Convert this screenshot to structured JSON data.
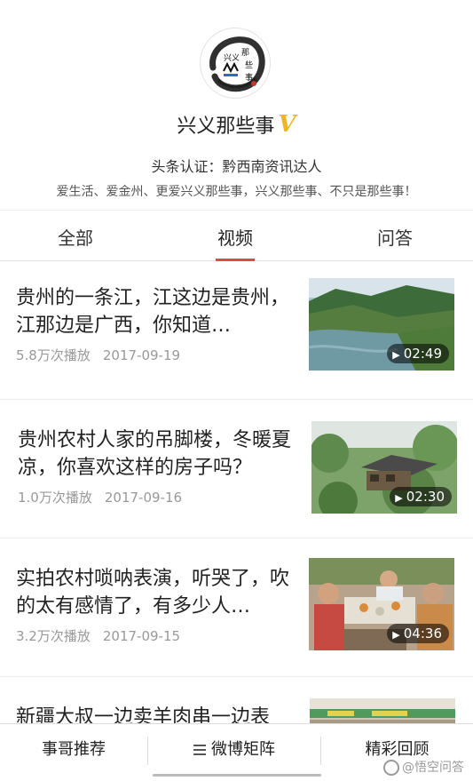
{
  "profile": {
    "avatar_text": "兴义那些事",
    "name": "兴义那些事",
    "verified_badge": "V",
    "certification": "头条认证：黔西南资讯达人",
    "motto": "爱生活、爱金州、更爱兴义那些事，兴义那些事、不只是那些事！"
  },
  "tabs": [
    {
      "label": "全部",
      "active": false
    },
    {
      "label": "视频",
      "active": true
    },
    {
      "label": "问答",
      "active": false
    }
  ],
  "feed": [
    {
      "title": "贵州的一条江，江这边是贵州，江那边是广西，你知道…",
      "views": "5.8万次播放",
      "date": "2017-09-19",
      "duration": "02:49"
    },
    {
      "title": "贵州农村人家的吊脚楼，冬暖夏凉，你喜欢这样的房子吗？",
      "views": "1.0万次播放",
      "date": "2017-09-16",
      "duration": "02:30"
    },
    {
      "title": "实拍农村唢呐表演，听哭了，吹的太有感情了，有多少人…",
      "views": "3.2万次播放",
      "date": "2017-09-15",
      "duration": "04:36"
    },
    {
      "title": "新疆大叔一边卖羊肉串一边表",
      "views": "",
      "date": "",
      "duration": ""
    }
  ],
  "bottom_bar": {
    "left": "事哥推荐",
    "middle": "微博矩阵",
    "right": "精彩回顾"
  },
  "watermark": "@悟空问答",
  "colors": {
    "accent": "#e04a3a",
    "verified": "#f0b429",
    "meta_text": "#999999"
  }
}
